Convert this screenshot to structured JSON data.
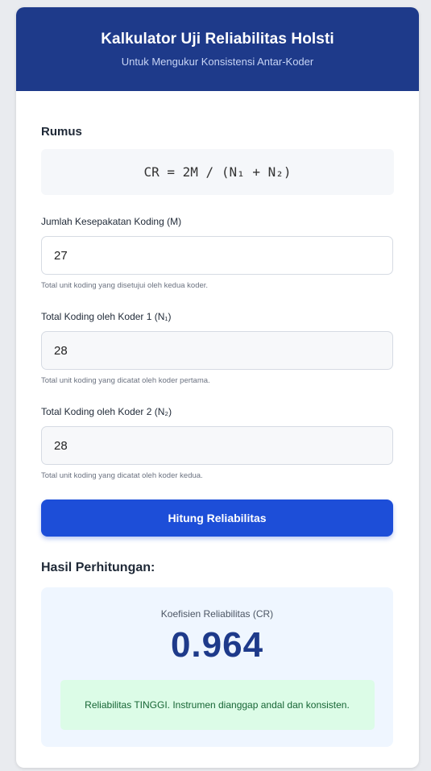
{
  "header": {
    "title": "Kalkulator Uji Reliabilitas Holsti",
    "subtitle": "Untuk Mengukur Konsistensi Antar-Koder"
  },
  "formula": {
    "heading": "Rumus",
    "expression": "CR = 2M / (N₁ + N₂)"
  },
  "fields": [
    {
      "label": "Jumlah Kesepakatan Koding (M)",
      "value": "27",
      "hint": "Total unit koding yang disetujui oleh kedua koder."
    },
    {
      "label": "Total Koding oleh Koder 1 (N₁)",
      "value": "28",
      "hint": "Total unit koding yang dicatat oleh koder pertama."
    },
    {
      "label": "Total Koding oleh Koder 2 (N₂)",
      "value": "28",
      "hint": "Total unit koding yang dicatat oleh koder kedua."
    }
  ],
  "button": {
    "label": "Hitung Reliabilitas"
  },
  "result": {
    "heading": "Hasil Perhitungan:",
    "coef_label": "Koefisien Reliabilitas (CR)",
    "coef_value": "0.964",
    "verdict": "Reliabilitas TINGGI. Instrumen dianggap andal dan konsisten."
  },
  "colors": {
    "header_bg": "#1e3a8a",
    "button_bg": "#1d4ed8",
    "result_bg": "#eff6ff",
    "verdict_bg": "#dcfce7",
    "verdict_text": "#166534"
  }
}
